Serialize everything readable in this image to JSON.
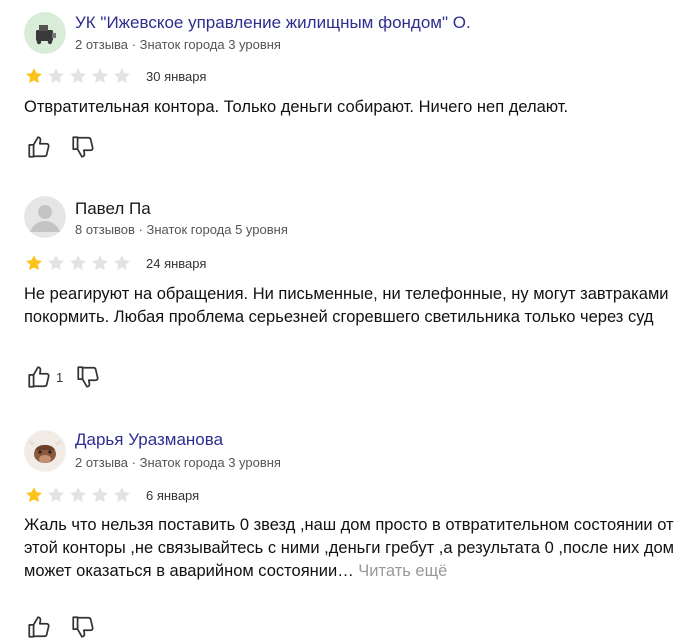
{
  "reviews": [
    {
      "author": "УК \"Ижевское управление жилищным фондом\" О.",
      "meta": "2 отзыва · Знаток города 3 уровня",
      "rating": 1,
      "date": "30 января",
      "text": "Отвратительная контора. Только деньги собирают. Ничего неп делают.",
      "likes": ""
    },
    {
      "author": "Павел Па",
      "meta": "8 отзывов · Знаток города 5 уровня",
      "rating": 1,
      "date": "24 января",
      "text": "Не реагируют на обращения. Ни письменные, ни телефонные, ну могут завтраками покормить. Любая проблема серьезней сгоревшего светильника только через суд",
      "likes": "1"
    },
    {
      "author": "Дарья Уразманова",
      "meta": "2 отзыва · Знаток города 3 уровня",
      "rating": 1,
      "date": "6 января",
      "text": "Жаль что нельзя поставить 0 звезд ,наш дом просто в отвратительном состоянии от этой конторы ,не связывайтесь с ними ,деньги гребут ,а результата 0 ,после них дом может оказаться в аварийном состоянии…",
      "read_more": "Читать ещё",
      "likes": ""
    }
  ],
  "colors": {
    "star_filled": "#fcc21b",
    "star_empty": "#e3e3e3",
    "link_author": "#2e2e8f",
    "read_more": "#999999"
  },
  "icons": {
    "like": "thumb-up-icon",
    "dislike": "thumb-down-icon"
  }
}
